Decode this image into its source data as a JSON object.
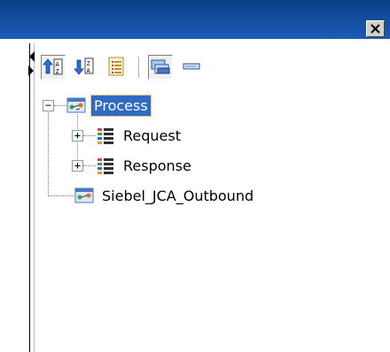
{
  "tree": {
    "nodes": [
      {
        "label": "Process"
      },
      {
        "label": "Request"
      },
      {
        "label": "Response"
      },
      {
        "label": "Siebel_JCA_Outbound"
      }
    ]
  },
  "toolbar": {
    "buttons": [
      "sort-ascending-icon",
      "sort-descending-icon",
      "list-icon",
      "hierarchy-icon",
      "minimize-icon"
    ]
  }
}
